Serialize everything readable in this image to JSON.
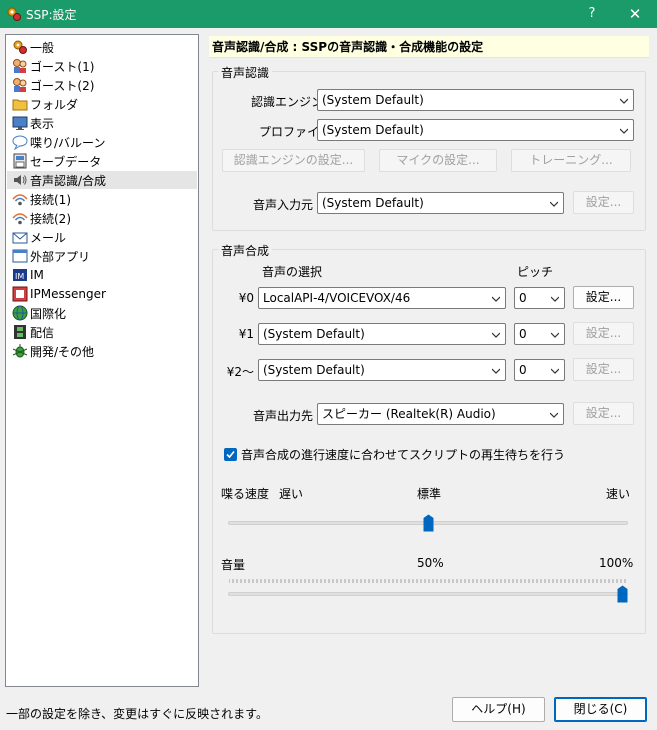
{
  "window": {
    "title": "SSP:設定",
    "help_glyph": "?",
    "close_glyph": "✕"
  },
  "sidebar": {
    "items": [
      {
        "label": "一般",
        "icon": "gears-icon"
      },
      {
        "label": "ゴースト(1)",
        "icon": "ghost-icon"
      },
      {
        "label": "ゴースト(2)",
        "icon": "ghost-icon"
      },
      {
        "label": "フォルダ",
        "icon": "folder-icon"
      },
      {
        "label": "表示",
        "icon": "monitor-icon"
      },
      {
        "label": "喋り/バルーン",
        "icon": "balloon-icon"
      },
      {
        "label": "セーブデータ",
        "icon": "save-icon"
      },
      {
        "label": "音声認識/合成",
        "icon": "speaker-icon"
      },
      {
        "label": "接続(1)",
        "icon": "wifi-icon"
      },
      {
        "label": "接続(2)",
        "icon": "wifi-icon"
      },
      {
        "label": "メール",
        "icon": "mail-icon"
      },
      {
        "label": "外部アプリ",
        "icon": "app-window-icon"
      },
      {
        "label": "IM",
        "icon": "im-icon"
      },
      {
        "label": "IPMessenger",
        "icon": "ipmessenger-icon"
      },
      {
        "label": "国際化",
        "icon": "globe-icon"
      },
      {
        "label": "配信",
        "icon": "film-icon"
      },
      {
        "label": "開発/その他",
        "icon": "bug-icon"
      }
    ],
    "selected_index": 7
  },
  "header": {
    "title": "音声認識/合成 : SSPの音声認識・合成機能の設定"
  },
  "recognition": {
    "group_title": "音声認識",
    "engine_label": "認識エンジン",
    "engine_value": "(System Default)",
    "profile_label": "プロファイル",
    "profile_value": "(System Default)",
    "engine_settings_button": "認識エンジンの設定...",
    "mic_settings_button": "マイクの設定...",
    "training_button": "トレーニング...",
    "input_label": "音声入力元",
    "input_value": "(System Default)",
    "input_settings_button": "設定..."
  },
  "synthesis": {
    "group_title": "音声合成",
    "voice_header": "音声の選択",
    "pitch_header": "ピッチ",
    "rows": [
      {
        "slot": "¥0",
        "voice": "LocalAPI-4/VOICEVOX/46",
        "pitch": "0",
        "settings": "設定..."
      },
      {
        "slot": "¥1",
        "voice": "(System Default)",
        "pitch": "0",
        "settings": "設定..."
      },
      {
        "slot": "¥2〜",
        "voice": "(System Default)",
        "pitch": "0",
        "settings": "設定..."
      }
    ],
    "output_label": "音声出力先",
    "output_value": "スピーカー (Realtek(R) Audio)",
    "output_settings_button": "設定...",
    "wait_checkbox_label": "音声合成の進行速度に合わせてスクリプトの再生待ちを行う",
    "wait_checked": true,
    "speed_label": "喋る速度",
    "speed_slow": "遅い",
    "speed_normal": "標準",
    "speed_fast": "速い",
    "speed_position": 0.5,
    "volume_label": "音量",
    "volume_mid": "50%",
    "volume_max": "100%",
    "volume_position": 1.0
  },
  "footer": {
    "status": "一部の設定を除き、変更はすぐに反映されます。",
    "help_button": "ヘルプ(H)",
    "close_button": "閉じる(C)"
  },
  "colors": {
    "titlebar": "#1b9a6a",
    "accent": "#0067c0",
    "header_band": "#ffffe1"
  }
}
